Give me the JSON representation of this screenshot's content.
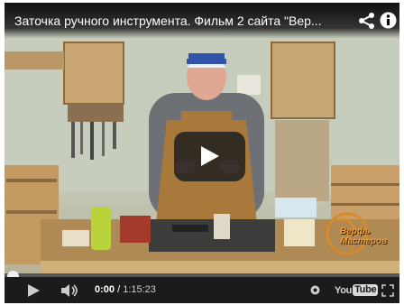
{
  "video": {
    "title": "Заточка ручного инструмента. Фильм 2 сайта \"Вер...",
    "logo_text_line1": "Верфь",
    "logo_text_line2": "Мастеров"
  },
  "controls": {
    "current_time": "0:00",
    "separator": "/",
    "duration": "1:15:23",
    "youtube_you": "You",
    "youtube_tube": "Tube",
    "progress_fraction": 0.0
  },
  "colors": {
    "progress_fill": "#e62117",
    "control_bar": "#1b1b1b"
  },
  "icons": {
    "share": "share-icon",
    "info": "info-icon",
    "play": "play-icon",
    "volume": "volume-icon",
    "settings": "gear-icon",
    "fullscreen": "fullscreen-icon"
  }
}
